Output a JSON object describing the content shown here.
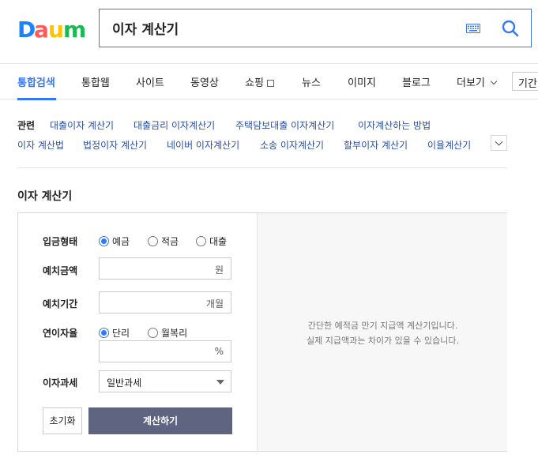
{
  "logo": {
    "text": "Daum",
    "colors": [
      "#1a83ff",
      "#ff5959",
      "#ffc400",
      "#1bb954",
      "#ff5959"
    ]
  },
  "search": {
    "value": "이자 계산기",
    "accent": "#3478f6"
  },
  "tabs": [
    {
      "label": "통합검색",
      "active": true
    },
    {
      "label": "통합웹"
    },
    {
      "label": "사이트"
    },
    {
      "label": "동영상"
    },
    {
      "label": "쇼핑"
    },
    {
      "label": "뉴스"
    },
    {
      "label": "이미지"
    },
    {
      "label": "블로그"
    },
    {
      "label": "더보기"
    }
  ],
  "period_label": "기간",
  "related": {
    "label": "관련",
    "items": [
      "대출이자 계산기",
      "대출금리 이자계산기",
      "주택담보대출 이자계산기",
      "이자계산하는 방법",
      "이자 계산법",
      "법정이자 계산기",
      "네이버 이자계산기",
      "소송 이자계산기",
      "할부이자 계산기",
      "이율계산기"
    ]
  },
  "calculator": {
    "title": "이자 계산기",
    "deposit_type": {
      "label": "입금형태",
      "options": [
        "예금",
        "적금",
        "대출"
      ],
      "selected": "예금"
    },
    "amount": {
      "label": "예치금액",
      "value": "",
      "unit": "원"
    },
    "period": {
      "label": "예치기간",
      "value": "",
      "unit": "개월"
    },
    "rate": {
      "label": "연이자율",
      "options": [
        "단리",
        "월복리"
      ],
      "selected": "단리",
      "value": "",
      "unit": "%"
    },
    "tax": {
      "label": "이자과세",
      "selected": "일반과세"
    },
    "reset_label": "초기화",
    "calc_label": "계산하기",
    "description_line1": "간단한 예적금 만기 지급액 계산기입니다.",
    "description_line2": "실제 지급액과는 차이가 있을 수 있습니다."
  }
}
